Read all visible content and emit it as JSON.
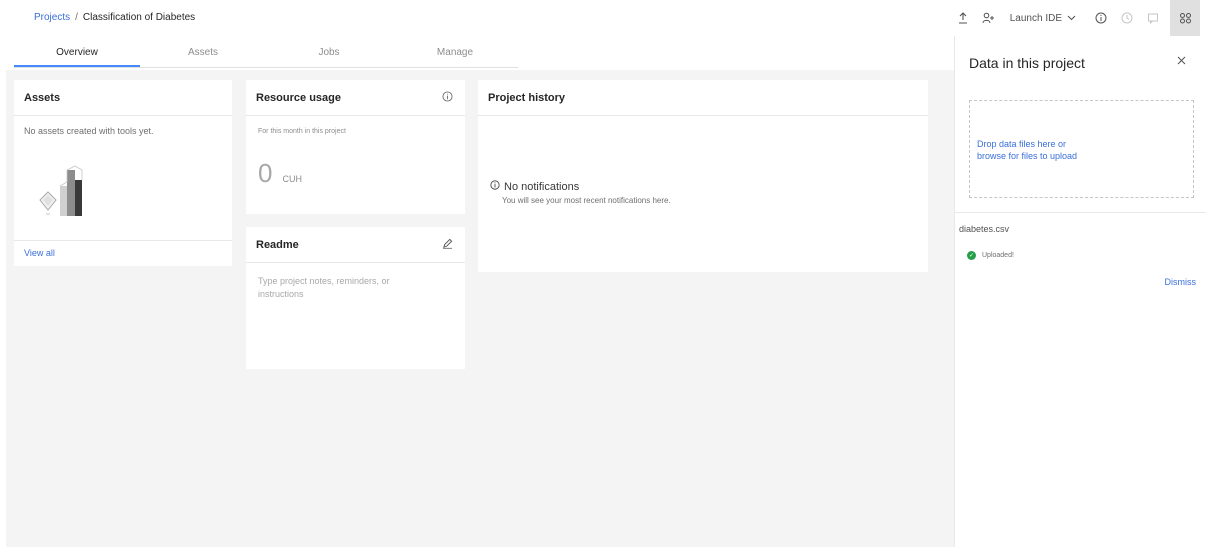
{
  "breadcrumb": {
    "root": "Projects",
    "separator": "/",
    "current": "Classification of Diabetes"
  },
  "toolbar": {
    "launch_label": "Launch IDE",
    "icons": [
      "upload-icon",
      "add-collaborator-icon",
      "chevron-down-icon",
      "info-icon",
      "history-icon",
      "comment-icon",
      "data-panel-icon"
    ]
  },
  "tabs": [
    {
      "label": "Overview",
      "selected": true
    },
    {
      "label": "Assets",
      "selected": false
    },
    {
      "label": "Jobs",
      "selected": false
    },
    {
      "label": "Manage",
      "selected": false
    }
  ],
  "assets_card": {
    "title": "Assets",
    "empty_text": "No assets created with tools yet.",
    "view_all": "View all"
  },
  "resource_card": {
    "title": "Resource usage",
    "subtitle": "For this month in this project",
    "value": "0",
    "unit": "CUH"
  },
  "readme_card": {
    "title": "Readme",
    "placeholder": "Type project notes, reminders, or instructions"
  },
  "history_card": {
    "title": "Project history",
    "empty_title": "No notifications",
    "empty_desc": "You will see your most recent notifications here."
  },
  "data_panel": {
    "title": "Data in this project",
    "dropzone_line1": "Drop data files here or",
    "dropzone_line2": "browse for files to upload",
    "file_name": "diabetes.csv",
    "file_status": "Uploaded!",
    "dismiss": "Dismiss"
  },
  "colors": {
    "link": "#3a6fd8",
    "tab_indicator": "#4589ff",
    "success": "#24a148",
    "background": "#f4f4f4"
  }
}
